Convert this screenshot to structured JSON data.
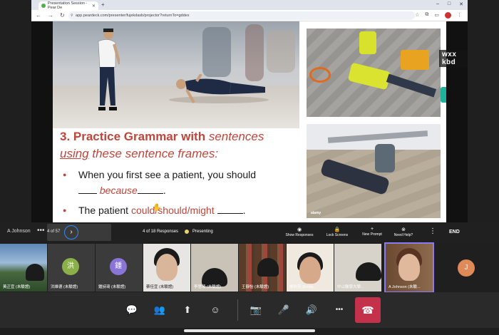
{
  "browser": {
    "tab_title": "Presentation Session - Pear De",
    "new_tab": "+",
    "url": "app.peardeck.com/presenter/fujekdasb/projector?returnTo=gddex",
    "window_controls": [
      "–",
      "□",
      "✕"
    ]
  },
  "slide": {
    "heading_bold": "3. Practice Grammar with",
    "heading_italic_1": "sentences",
    "heading_italic_2_underlined": "using",
    "heading_italic_3": "these sentence frames:",
    "bullet1_text": "When you first see a patient, you should",
    "bullet1_line2_pre": "",
    "bullet1_because": "because",
    "bullet1_end": ".",
    "bullet2_pre": "The patient",
    "bullet2_modal": "could/should/might",
    "bullet2_end": ".",
    "photo_credit": "alamy",
    "overlay_badge": "wxx kbd"
  },
  "peardeck_bar": {
    "presenter": "A Johnson",
    "more": "•••",
    "slide_count": "4 of 57",
    "next": "›",
    "responses": "4 of 18 Responses",
    "presenting": "Presenting",
    "controls": [
      {
        "icon": "eye-icon",
        "glyph": "◉",
        "label": "Show Responses"
      },
      {
        "icon": "lock-icon",
        "glyph": "🔒",
        "label": "Lock Screens"
      },
      {
        "icon": "plus-icon",
        "glyph": "+",
        "label": "New Prompt"
      },
      {
        "icon": "help-icon",
        "glyph": "⊗",
        "label": "Need Help?"
      }
    ],
    "kebab": "⋮",
    "end": "END"
  },
  "participants": [
    {
      "name": "黃正宜 (未驗證)",
      "kind": "video-mountain"
    },
    {
      "name": "洪維德 (未驗證)",
      "kind": "avatar",
      "initial": "洪",
      "color": "#8bb04a"
    },
    {
      "name": "鍾詩琦 (未驗證)",
      "kind": "avatar",
      "initial": "鍾",
      "color": "#8a74d6"
    },
    {
      "name": "蔡佳宜 (未驗證)",
      "kind": "video-white"
    },
    {
      "name": "李慧琦 (未驗證)",
      "kind": "video-room"
    },
    {
      "name": "王靜怡 (未驗證)",
      "kind": "video-shelf"
    },
    {
      "name": "柳秋芳 (Emily...",
      "kind": "video-white"
    },
    {
      "name": "中山醫學大學...",
      "kind": "video-room"
    },
    {
      "name": "A Johnson (未驗...",
      "kind": "video-shelf",
      "active": true
    }
  ],
  "extra_participant_initial": "J",
  "meeting_controls": [
    {
      "icon": "chat-icon",
      "glyph": "💬"
    },
    {
      "icon": "people-icon",
      "glyph": "👥"
    },
    {
      "icon": "share-icon",
      "glyph": "⬆"
    },
    {
      "icon": "reactions-icon",
      "glyph": "☺"
    },
    {
      "icon": "camera-off-icon",
      "glyph": "📷"
    },
    {
      "icon": "mic-off-icon",
      "glyph": "🎤"
    },
    {
      "icon": "speaker-icon",
      "glyph": "🔊"
    },
    {
      "icon": "more-icon",
      "glyph": "•••"
    }
  ],
  "leave_glyph": "☎"
}
